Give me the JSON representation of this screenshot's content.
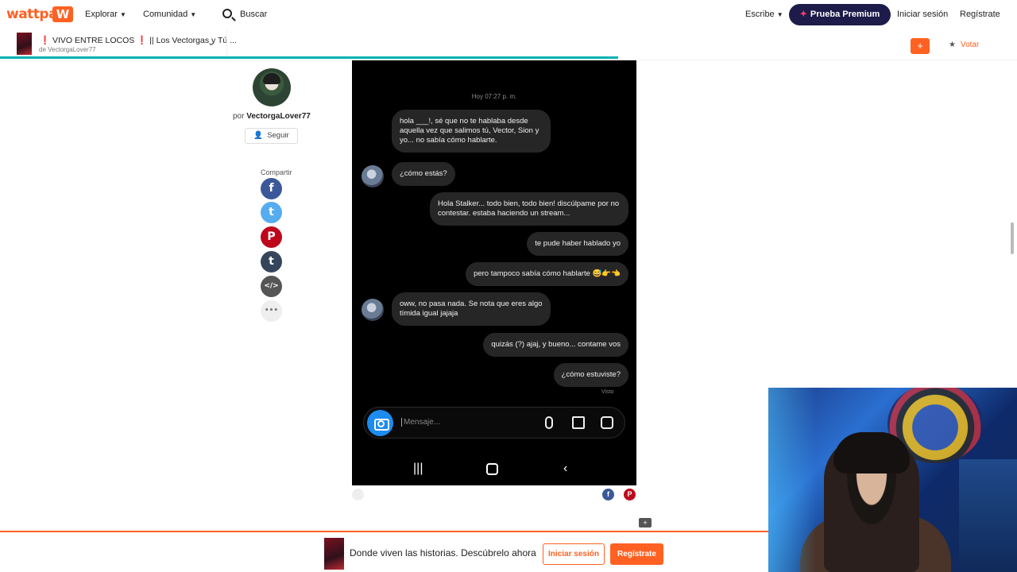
{
  "nav": {
    "logo": "wattpad",
    "explore": "Explorar",
    "community": "Comunidad",
    "search_placeholder": "Buscar",
    "write": "Escribe",
    "premium": "Prueba Premium",
    "login": "Iniciar sesión",
    "signup": "Regístrate"
  },
  "story": {
    "title_prefix": "❗",
    "title_main": "VIVO ENTRE LOCOS",
    "title_suffix": "❗ || Los Vectorgas y Tú ...",
    "author_line": "de VectorgaLover77",
    "add": "+",
    "vote": "Votar"
  },
  "author": {
    "by": "por",
    "name": "VectorgaLover77",
    "follow": "Seguir",
    "share_label": "Compartir"
  },
  "share_icons": [
    {
      "name": "facebook-icon",
      "glyph": "f",
      "color": "#3b5998"
    },
    {
      "name": "twitter-icon",
      "glyph": "t",
      "color": "#55acee"
    },
    {
      "name": "pinterest-icon",
      "glyph": "P",
      "color": "#bd081c"
    },
    {
      "name": "tumblr-icon",
      "glyph": "t",
      "color": "#35465c"
    },
    {
      "name": "embed-icon",
      "glyph": "</>",
      "color": "#555555"
    },
    {
      "name": "more-icon",
      "glyph": "•••",
      "color": "#eeeeee"
    }
  ],
  "chat": {
    "timestamp": "Hoy 07:27 p. m.",
    "messages": [
      {
        "side": "left",
        "avatar": false,
        "text": "hola ___!, sé que no te hablaba desde aquella vez que salimos tú, Vector, Sion y yo... no sabía cómo hablarte."
      },
      {
        "side": "left",
        "avatar": true,
        "text": "¿cómo estás?"
      },
      {
        "side": "right",
        "text": "Hola Stalker... todo bien, todo bien! discúlpame por no contestar. estaba haciendo un stream..."
      },
      {
        "side": "right",
        "text": "te pude haber hablado yo"
      },
      {
        "side": "right",
        "text": "pero tampoco sabía cómo hablarte 😅👉👈"
      },
      {
        "side": "left",
        "avatar": true,
        "text": "oww, no pasa nada. Se nota que eres algo tímida igual jajaja"
      },
      {
        "side": "right",
        "text": "quizás (?) ajaj, y bueno... contame vos"
      },
      {
        "side": "right",
        "text": "¿cómo estuviste?"
      }
    ],
    "seen": "Visto",
    "input_placeholder": "Mensaje..."
  },
  "banner": {
    "text": "Donde viven las historias. Descúbrelo ahora",
    "login": "Iniciar sesión",
    "signup": "Regístrate"
  },
  "colors": {
    "brand": "#ff6122",
    "premium": "#1c1b4a",
    "progress": "#00b2b2",
    "chat_bg": "#000000",
    "bubble": "#262626"
  }
}
